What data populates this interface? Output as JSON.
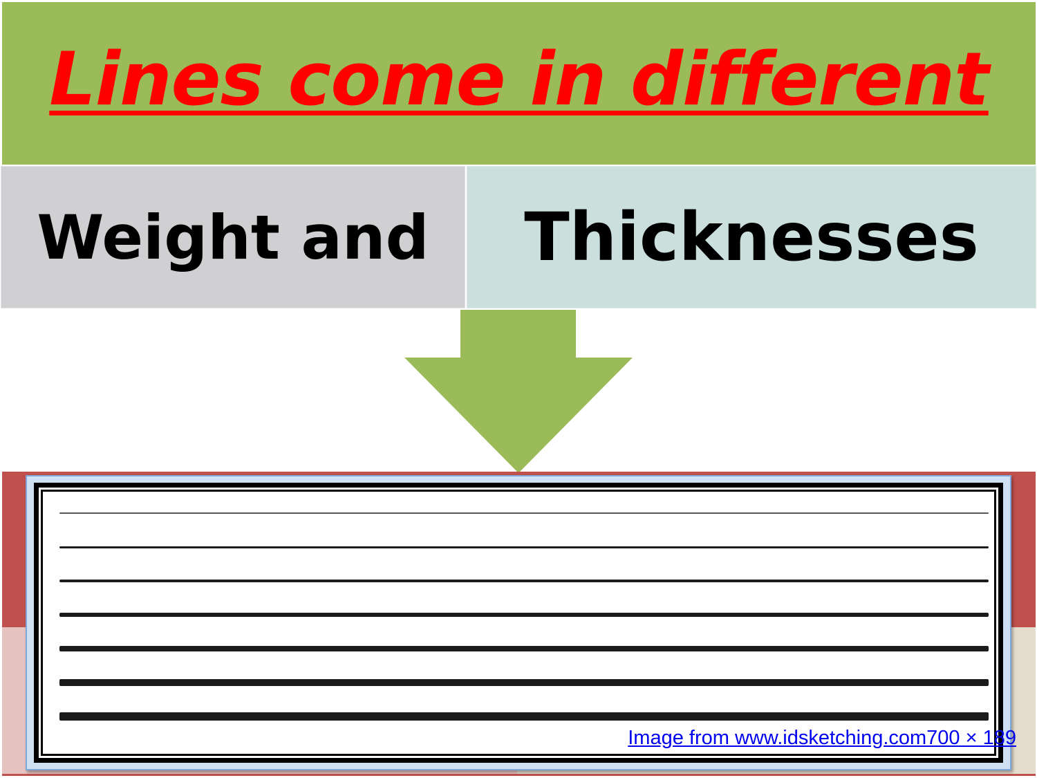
{
  "title": "Lines come in different",
  "box_left": {
    "text": "Weight and"
  },
  "box_right": {
    "text": "Thicknesses"
  },
  "caption": "Image from www.idsketching.com700 × 189",
  "colors": {
    "title_band": "#9bbb59",
    "title_text": "#ff0000",
    "box_left": "#d0d0d3",
    "box_right": "#cbe0dd",
    "arrow": "#9bbb59",
    "bottom_band": "#c0504d",
    "link": "#0000ee"
  },
  "icons": {
    "arrow": "down-arrow-icon"
  },
  "line_samples": {
    "count": 7,
    "description_order": "thin-to-thick"
  }
}
